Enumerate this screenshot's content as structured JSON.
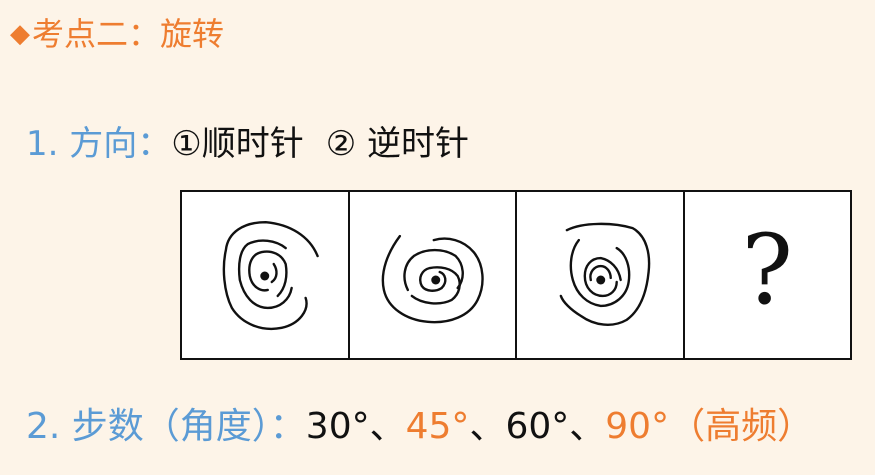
{
  "title": {
    "bullet": "◆",
    "text": "考点二：旋转"
  },
  "direction": {
    "label": "1. 方向：",
    "option1": "①顺时针",
    "option2": "② 逆时针"
  },
  "figure": {
    "question_mark": "?"
  },
  "steps": {
    "label": "2. 步数（角度）：",
    "v30": "30°",
    "sep1": "、",
    "v45": "45°",
    "sep2": "、",
    "v60": "60°",
    "sep3": "、",
    "v90": "90°",
    "note": "（高频）"
  },
  "colors": {
    "accent_orange": "#ee7d30",
    "accent_blue": "#5b9bd5",
    "background": "#fdf4e8"
  }
}
